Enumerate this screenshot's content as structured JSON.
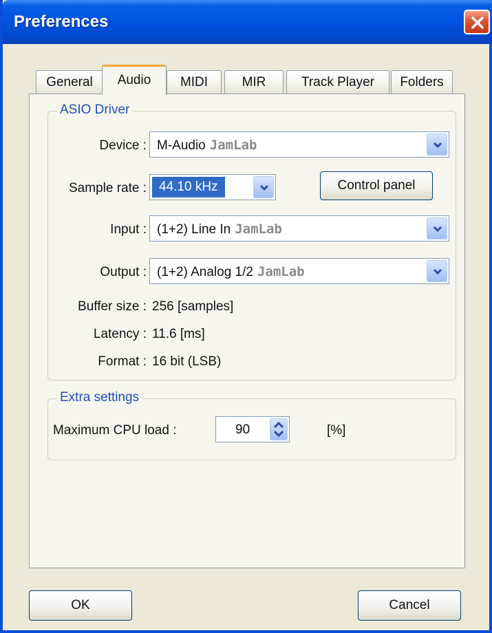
{
  "window": {
    "title": "Preferences"
  },
  "tabs": [
    {
      "label": "General"
    },
    {
      "label": "Audio"
    },
    {
      "label": "MIDI"
    },
    {
      "label": "MIR"
    },
    {
      "label": "Track Player"
    },
    {
      "label": "Folders"
    }
  ],
  "active_tab": "Audio",
  "asio": {
    "group_title": "ASIO Driver",
    "device_label": "Device :",
    "device_value": "M-Audio",
    "device_brand": "JamLab",
    "sample_rate_label": "Sample rate :",
    "sample_rate_value": "44.10 kHz",
    "control_panel_label": "Control panel",
    "input_label": "Input :",
    "input_value": "(1+2) Line In",
    "input_brand": "JamLab",
    "output_label": "Output :",
    "output_value": "(1+2) Analog 1/2",
    "output_brand": "JamLab",
    "buffer_label": "Buffer size :",
    "buffer_value": "256 [samples]",
    "latency_label": "Latency :",
    "latency_value": "11.6 [ms]",
    "format_label": "Format :",
    "format_value": "16 bit (LSB)"
  },
  "extra": {
    "group_title": "Extra settings",
    "cpu_label": "Maximum CPU load :",
    "cpu_value": "90",
    "cpu_unit": "[%]"
  },
  "buttons": {
    "ok": "OK",
    "cancel": "Cancel"
  },
  "colors": {
    "title_bar": "#0054e3",
    "close": "#e2583a",
    "selection": "#316ac5",
    "group_title": "#1d4fb8"
  },
  "icons": {
    "close": "close-icon",
    "dropdown": "chevron-down-icon",
    "spinner": "spin-arrows-icon"
  }
}
